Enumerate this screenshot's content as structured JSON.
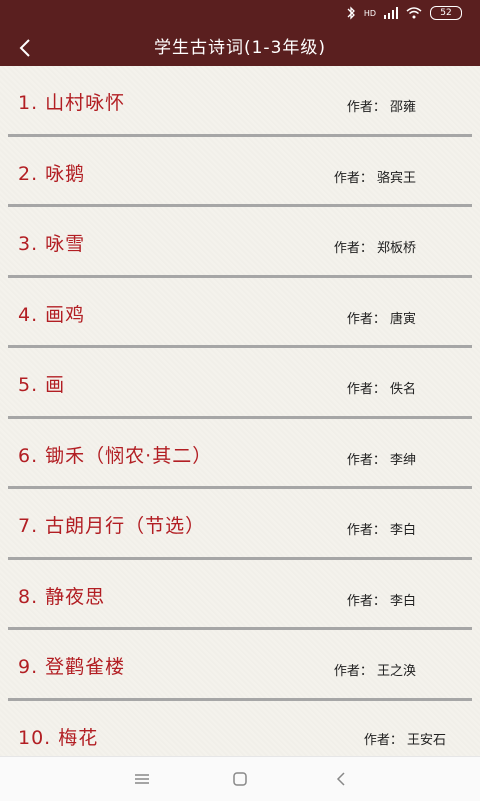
{
  "app": {
    "title": "学生古诗词(1-3年级)"
  },
  "status": {
    "battery": "52",
    "network": "HD"
  },
  "author_prefix": "作者：",
  "poems": [
    {
      "title": "1.  山村咏怀",
      "author": "作者：  邵雍"
    },
    {
      "title": "2.  咏鹅",
      "author": "作者：  骆宾王"
    },
    {
      "title": "3.  咏雪",
      "author": "作者：  郑板桥"
    },
    {
      "title": "4.  画鸡",
      "author": "作者：  唐寅"
    },
    {
      "title": "5.  画",
      "author": "作者：  佚名"
    },
    {
      "title": "6.  锄禾（悯农·其二）",
      "author": "作者：  李绅"
    },
    {
      "title": "7.  古朗月行（节选）",
      "author": "作者：  李白"
    },
    {
      "title": "8.  静夜思",
      "author": "作者：  李白"
    },
    {
      "title": "9.  登鹳雀楼",
      "author": "作者：  王之涣"
    },
    {
      "title": "10.  梅花",
      "author": "作者：  王安石"
    }
  ],
  "icons": {
    "back": "chevron-left-icon",
    "bluetooth": "bluetooth-icon",
    "signal": "signal-icon",
    "wifi": "wifi-icon",
    "battery": "battery-icon",
    "menu": "menu-icon",
    "home": "home-icon",
    "nav_back": "back-icon"
  },
  "colors": {
    "header": "#5a1f1f",
    "poem_title": "#b21e23",
    "background": "#f4f2ec"
  }
}
